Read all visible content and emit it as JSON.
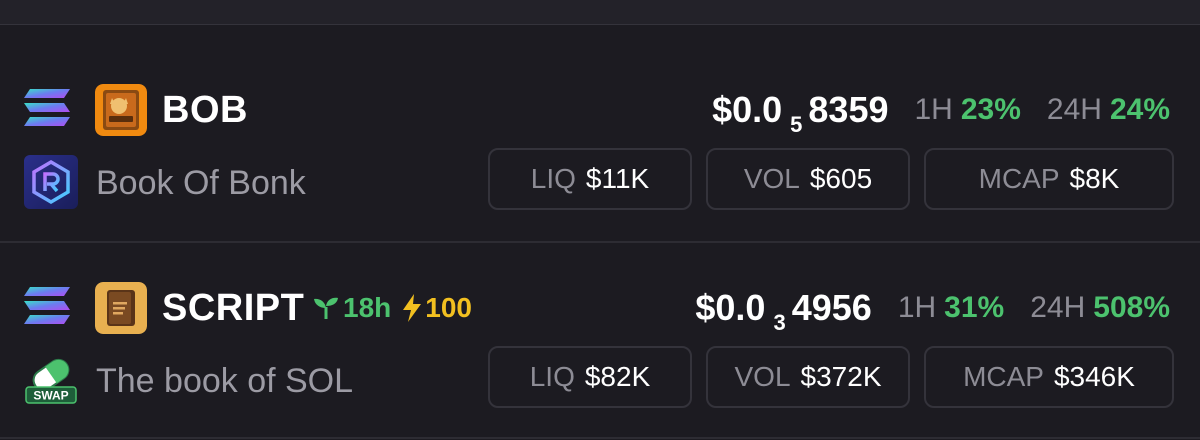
{
  "colors": {
    "background": "#1c1b21",
    "positive": "#4cc26e",
    "boost": "#f2c020",
    "muted": "#8d8c95",
    "border": "#34333b"
  },
  "tokens": [
    {
      "symbol": "BOB",
      "name": "Book Of Bonk",
      "chain_icon": "solana-icon",
      "dex_icon": "raydium-icon",
      "price_prefix": "$0.0",
      "price_zeros": "5",
      "price_digits": "8359",
      "h1_label": "1H",
      "h1_value": "23%",
      "h24_label": "24H",
      "h24_value": "24%",
      "liq_label": "LIQ",
      "liq_value": "$11K",
      "vol_label": "VOL",
      "vol_value": "$605",
      "mcap_label": "MCAP",
      "mcap_value": "$8K"
    },
    {
      "symbol": "SCRIPT",
      "name": "The book of SOL",
      "chain_icon": "solana-icon",
      "dex_icon": "swap-pill-icon",
      "age": "18h",
      "boost": "100",
      "dex_badge": "SWAP",
      "price_prefix": "$0.0",
      "price_zeros": "3",
      "price_digits": "4956",
      "h1_label": "1H",
      "h1_value": "31%",
      "h24_label": "24H",
      "h24_value": "508%",
      "liq_label": "LIQ",
      "liq_value": "$82K",
      "vol_label": "VOL",
      "vol_value": "$372K",
      "mcap_label": "MCAP",
      "mcap_value": "$346K"
    }
  ]
}
